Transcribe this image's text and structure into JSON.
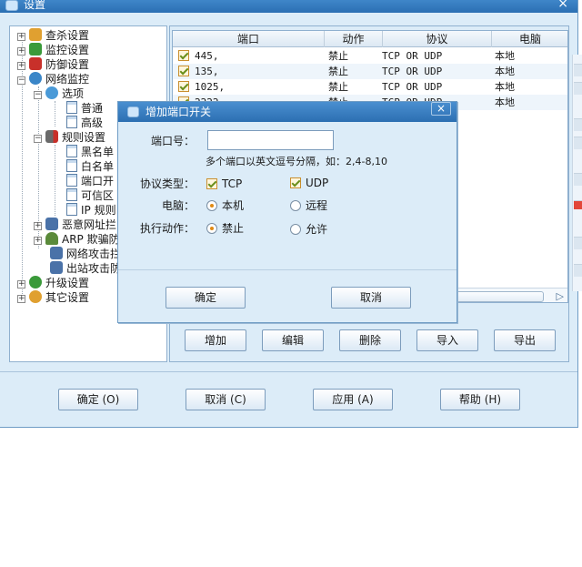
{
  "window": {
    "title": "设置",
    "close_glyph": "×"
  },
  "tree": {
    "items": [
      {
        "label": "查杀设置",
        "icon": "search-scan-icon",
        "color": "#e0a030"
      },
      {
        "label": "监控设置",
        "icon": "umbrella-icon",
        "color": "#3a9a3a"
      },
      {
        "label": "防御设置",
        "icon": "shield-icon",
        "color": "#c8302a"
      },
      {
        "label": "网络监控",
        "icon": "network-globe-icon",
        "color": "#3a86c8"
      },
      {
        "label": "选项",
        "icon": "options-gear-icon",
        "color": "#4a9ad8"
      },
      {
        "label": "普通",
        "icon": "document-icon"
      },
      {
        "label": "高级",
        "icon": "document-icon"
      },
      {
        "label": "规则设置",
        "icon": "rules-icon",
        "color": "#c8302a"
      },
      {
        "label": "黑名单",
        "icon": "document-icon"
      },
      {
        "label": "白名单",
        "icon": "document-icon"
      },
      {
        "label": "端口开",
        "icon": "document-icon"
      },
      {
        "label": "可信区",
        "icon": "document-icon"
      },
      {
        "label": "IP 规则",
        "icon": "document-icon"
      },
      {
        "label": "恶意网址拦",
        "icon": "computer-icon",
        "color": "#4a72a8"
      },
      {
        "label": "ARP 欺骗防",
        "icon": "person-icon",
        "color": "#5a8a3a"
      },
      {
        "label": "网络攻击拦",
        "icon": "computer-icon",
        "color": "#4a72a8"
      },
      {
        "label": "出站攻击防",
        "icon": "computer-icon",
        "color": "#4a72a8"
      },
      {
        "label": "升级设置",
        "icon": "upgrade-globe-icon",
        "color": "#3a9a3a"
      },
      {
        "label": "其它设置",
        "icon": "other-gear-icon",
        "color": "#e0a030"
      }
    ]
  },
  "ports_table": {
    "columns": [
      "端口",
      "动作",
      "协议",
      "电脑"
    ],
    "rows": [
      {
        "port": "445,",
        "action": "禁止",
        "protocol": "TCP OR UDP",
        "computer": "本地"
      },
      {
        "port": "135,",
        "action": "禁止",
        "protocol": "TCP OR UDP",
        "computer": "本地"
      },
      {
        "port": "1025,",
        "action": "禁止",
        "protocol": "TCP OR UDP",
        "computer": "本地"
      },
      {
        "port": "2222,",
        "action": "禁止",
        "protocol": "TCP OR UDP",
        "computer": "本地"
      }
    ],
    "scroll_arrow": "▷"
  },
  "panel_buttons": {
    "add": "增加",
    "edit": "编辑",
    "delete": "删除",
    "import": "导入",
    "export": "导出"
  },
  "bottom_buttons": {
    "ok": "确定 (O)",
    "cancel": "取消 (C)",
    "apply": "应用 (A)",
    "help": "帮助 (H)"
  },
  "dialog": {
    "title": "增加端口开关",
    "close_glyph": "×",
    "port_label": "端口号：",
    "port_value": "",
    "hint": "多个端口以英文逗号分隔，如：2,4-8,10",
    "protocol_label": "协议类型：",
    "tcp": "TCP",
    "udp": "UDP",
    "computer_label": "电脑：",
    "local": "本机",
    "remote": "远程",
    "action_label": "执行动作：",
    "deny": "禁止",
    "allow": "允许",
    "ok": "确定",
    "cancel": "取消"
  }
}
